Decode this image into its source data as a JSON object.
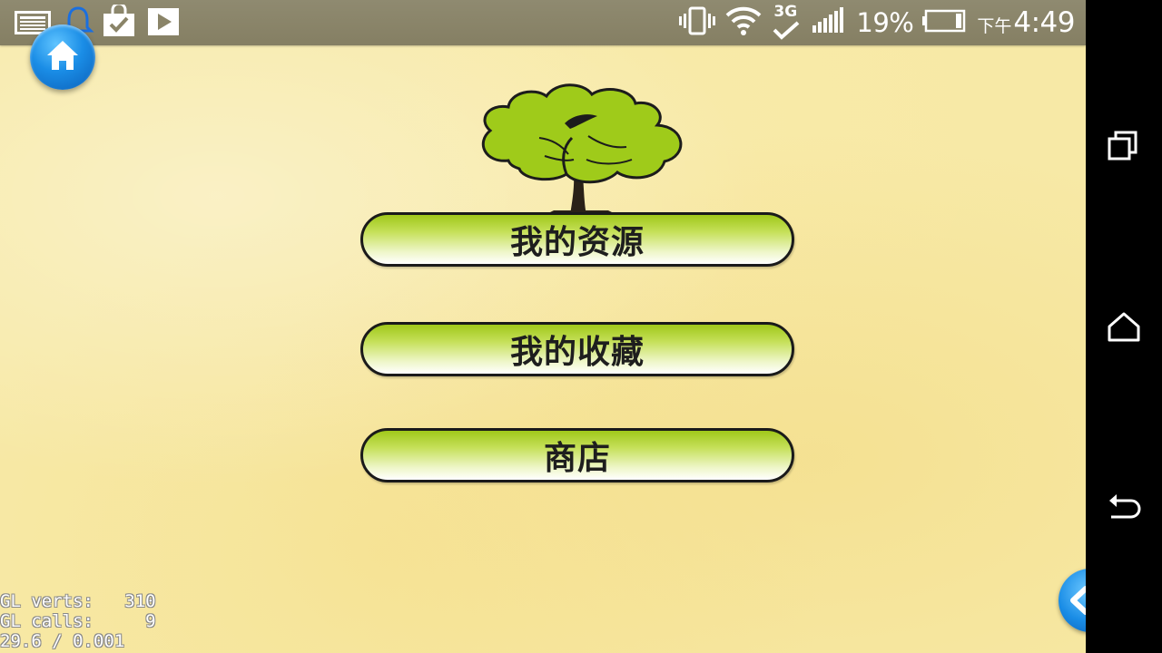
{
  "status_bar": {
    "left_icons": [
      "news-icon",
      "notification-bell-icon",
      "shopping-bag-check-icon",
      "play-store-icon"
    ],
    "right_icons": [
      "vibrate-icon",
      "wifi-icon",
      "3g-data-icon",
      "signal-icon",
      "battery-icon"
    ],
    "network_type": "3G",
    "battery_percent": "19%",
    "clock_ampm": "下午",
    "clock_time": "4:49"
  },
  "app": {
    "home_button_icon": "home-icon",
    "logo_icon": "tree-icon",
    "menu": [
      {
        "label": "我的资源"
      },
      {
        "label": "我的收藏"
      },
      {
        "label": "商店"
      }
    ],
    "debug": {
      "line1": "GL verts:   310",
      "line2": "GL calls:     9",
      "line3": "29.6 / 0.001"
    },
    "corner_icon": "back-arrow-icon"
  },
  "nav_bar": {
    "buttons": [
      "recents-icon",
      "home-icon",
      "back-icon"
    ]
  },
  "colors": {
    "status_bar": "#8a8468",
    "app_background": "#f7e9a6",
    "button_green": "#a0c81a",
    "home_blue": "#1a8de6"
  }
}
